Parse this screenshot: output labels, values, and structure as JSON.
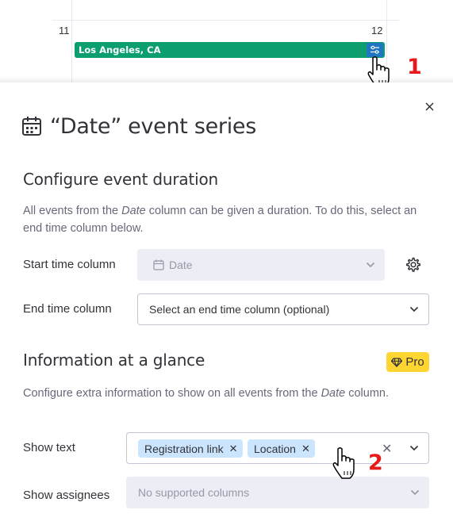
{
  "calendar": {
    "day_left": "11",
    "day_right": "12",
    "event_label": "Los Angeles, CA",
    "event_color": "#0d9e6f",
    "settings_color": "#1f76c2",
    "settings_icon": "sliders-icon"
  },
  "markers": {
    "step1": "1",
    "step2": "2",
    "color": "#e8191b"
  },
  "panel": {
    "title_icon": "calendar-icon",
    "title": "“Date” event series",
    "close_icon": "close-icon",
    "duration_section": {
      "title": "Configure event duration",
      "desc_before": "All events from the ",
      "desc_italic": "Date",
      "desc_after": " column can be given a duration. To do this, select an end time column below."
    },
    "start_time": {
      "label": "Start time column",
      "value": "Date",
      "value_icon": "calendar-icon",
      "settings_icon": "gear-icon"
    },
    "end_time": {
      "label": "End time column",
      "placeholder": "Select an end time column (optional)"
    },
    "glance_section": {
      "title": "Information at a glance",
      "badge": "Pro",
      "badge_icon": "diamond-icon",
      "badge_color": "#ffd533",
      "desc_before": "Configure extra information to show on all events from the ",
      "desc_italic": "Date",
      "desc_after": " column."
    },
    "show_text": {
      "label": "Show text",
      "chips": [
        "Registration link",
        "Location"
      ]
    },
    "show_assignees": {
      "label": "Show assignees",
      "placeholder": "No supported columns"
    }
  }
}
